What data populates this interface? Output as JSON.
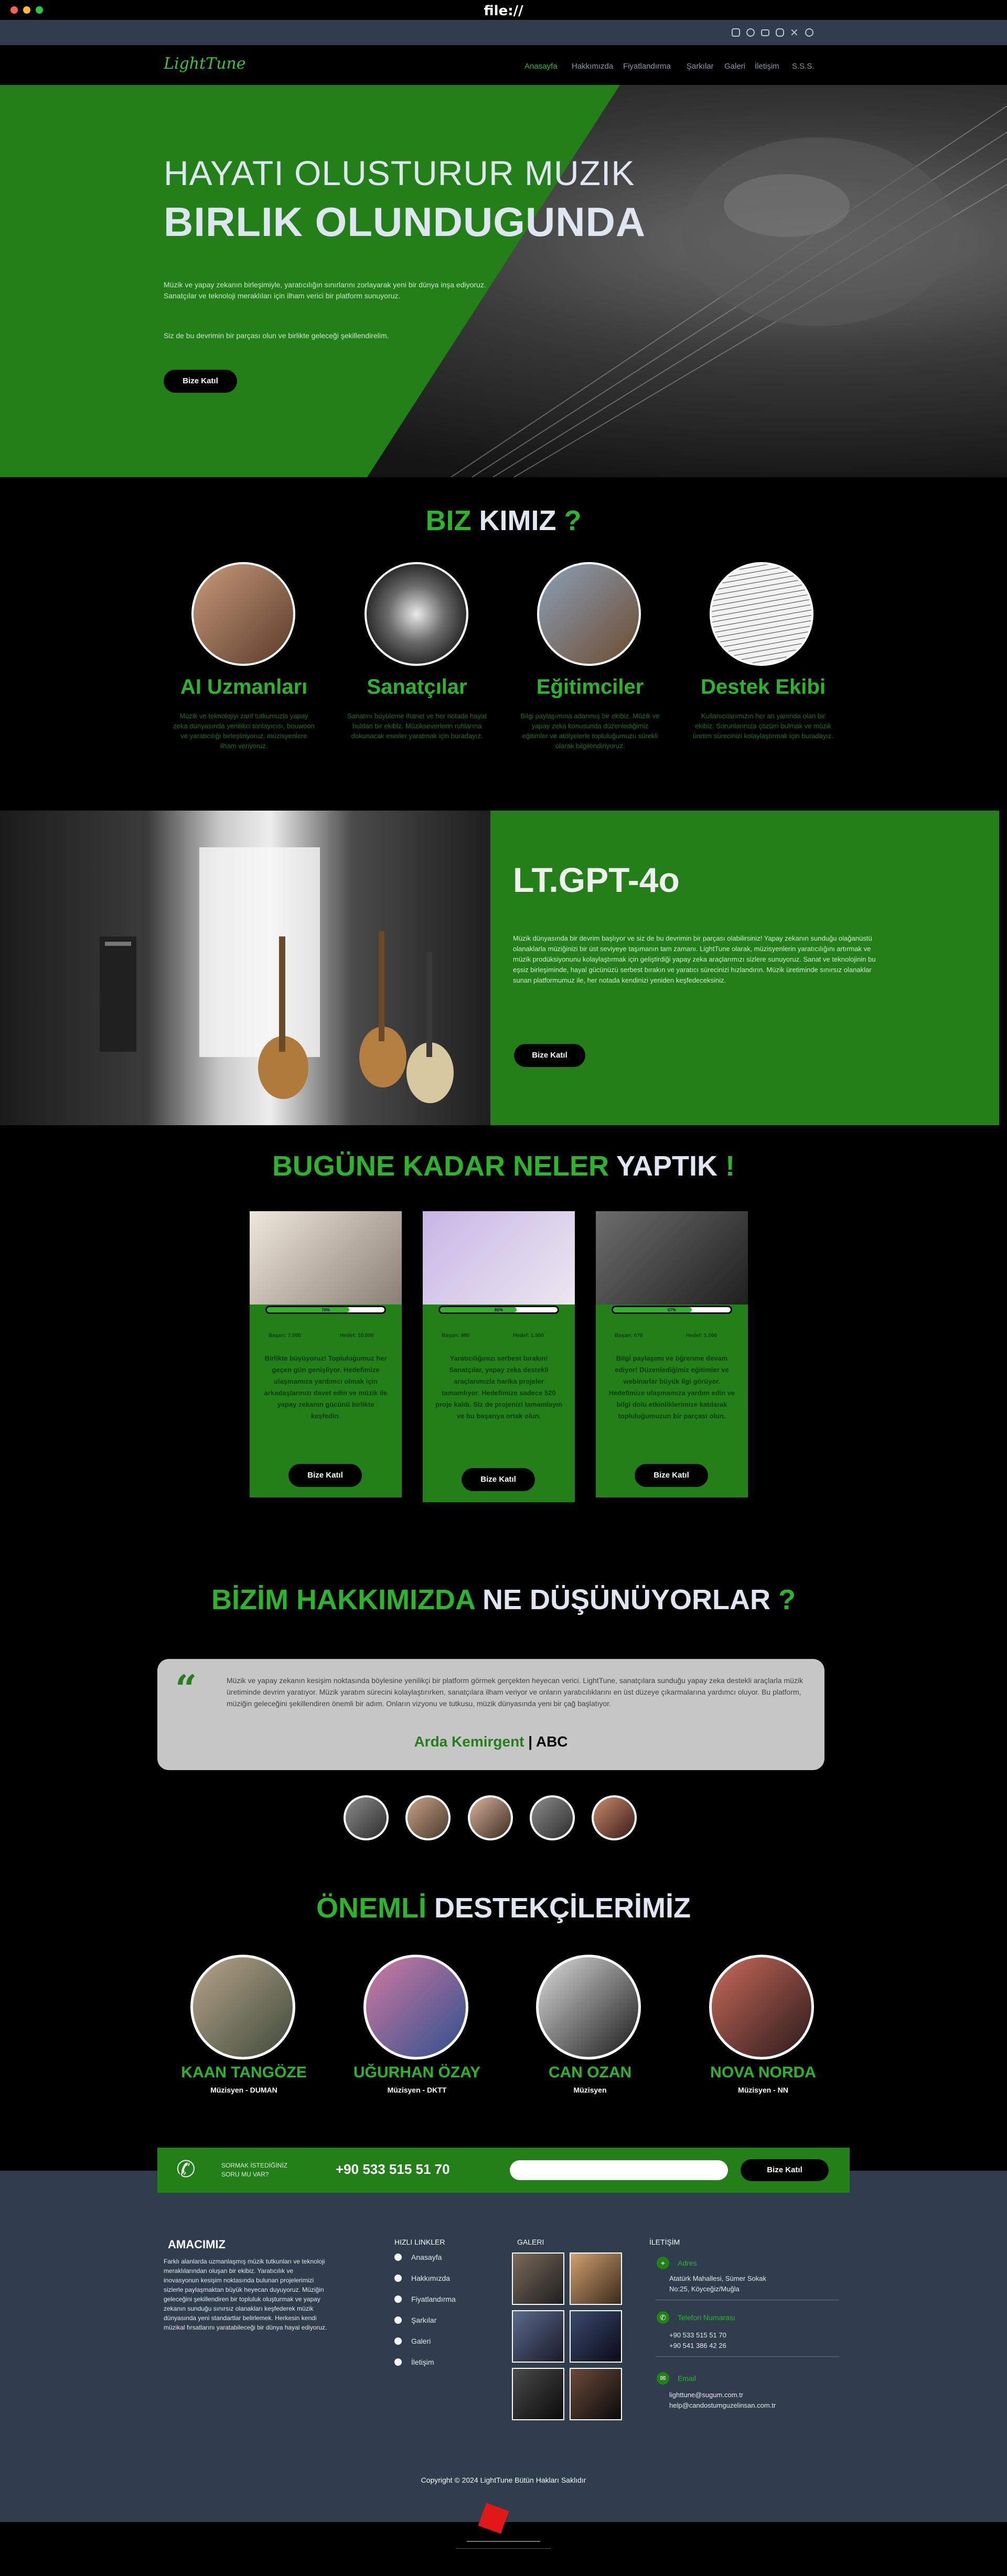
{
  "browser": {
    "url": "file://"
  },
  "nav": {
    "logo": "LightTune",
    "items": [
      "Anasayfa",
      "Hakkımızda",
      "Fiyatlandırma",
      "Şarkılar",
      "Galeri",
      "İletişim",
      "S.S.S."
    ],
    "active": "Anasayfa"
  },
  "hero": {
    "line1": "HAYATI OLUSTURUR MUZIK",
    "line2": "BIRLIK OLUNDUGUNDA",
    "p1": "Müzik ve yapay zekanın birleşimiyle, yaratıcılığın sınırlarını zorlayarak yeni bir dünya inşa ediyoruz. Sanatçılar ve teknoloji meraklıları için ilham verici bir platform sunuyoruz.",
    "p2": "Siz de bu devrimin bir parçası olun ve birlikte geleceği şekillendirelim.",
    "button": "Bize Katıl"
  },
  "about": {
    "title_a": "BIZ",
    "title_b": "KIMIZ",
    "title_c": "?",
    "team": [
      {
        "name": "AI Uzmanları",
        "desc": "Müzik ve teknolojiyi zarif tutkumuzla yapay zeka dünyasında yenilikci tonlayıcısı, bouwoon ve yaratıcılığı birleştiriyoruz, müzisyenlere ilham veriyoruz."
      },
      {
        "name": "Sanatçılar",
        "desc": "Sanatını büyüleme ihanet ve her notada hayat buldan bir ekiblz. Müzikseverlerin ruhlarına dokunacak eserler yaratmak için buradayız."
      },
      {
        "name": "Eğitimciler",
        "desc": "Bilgi paylaşımına adanmış bir ekibiz. Müzik ve yapay zeka konusunda düzenlediğimiz eğitimler ve atölyelerle topluluğumuzu sürekli olarak bilgilendiriyoruz."
      },
      {
        "name": "Destek Ekibi",
        "desc": "Kullanıcılarımızın her an yanında olan bir ekibiz. Sorunlarınıza çözüm bulmak ve müzik üretim sürecinizi kolaylaştırmak için buradayız."
      }
    ]
  },
  "lt": {
    "title": "LT.GPT-4o",
    "body": "Müzik dünyasında bir devrim başlıyor ve siz de bu devrimin bir parçası olabilirsiniz! Yapay zekanın sunduğu olağanüstü olanaklarla müziğinizi bir üst seviyeye taşımanın tam zamanı. LightTune olarak, müzisyenlerin yaratıcılığını artırmak ve müzik prodüksiyonunu kolaylaştırmak için geliştirdiği yapay zeka araçlarımızı sizlere sunuyoruz. Sanat ve teknolojinin bu eşsiz birleşiminde, hayal gücünüzü serbest bırakın ve yaratıcı sürecinizi hızlandırın. Müzik üretiminde sınırsız olanaklar sunan platformumuz ile, her notada kendinizi yeniden keşfedeceksiniz.",
    "button": "Bize Katıl"
  },
  "achievements": {
    "title_a": "BUGÜNE KADAR NELER",
    "title_b": "YAPTIK",
    "title_c": "!",
    "cards": [
      {
        "progress": 0.7,
        "progress_label": "70%",
        "left": "Başarı: 7.000",
        "right": "Hedef: 10.000",
        "text": "Birlikte büyüyoruz! Topluluğumuz her geçen gün genişliyor. Hedefimize ulaşmamıza yardımcı olmak için arkadaşlarınızı davet edin ve müzik ile yapay zekanın gücünü birlikte keşfedin.",
        "button": "Bize Katıl"
      },
      {
        "progress": 0.65,
        "progress_label": "65%",
        "left": "Başarı: 980",
        "right": "Hedef: 1.500",
        "text": "Yaratıcılığınızı serbest bırakın! Sanatçılar, yapay zeka destekli araçlarımızla harika projeler tamamlıyor. Hedefimize sadece 520 proje kaldı. Siz de projenizi tamamlayın ve bu başarıya ortak olun.",
        "button": "Bize Katıl"
      },
      {
        "progress": 0.67,
        "progress_label": "67%",
        "left": "Başarı: 670",
        "right": "Hedef: 1.000",
        "text": "Bilgi paylaşımı ve öğrenme devam ediyor! Düzenlediğimiz eğitimler ve webinarlar büyük ilgi görüyor. Hedefimize ulaşmamıza yardım edin ve bilgi dolu etkinliklerimize katılarak topluluğumuzun bir parçası olun.",
        "button": "Bize Katıl"
      }
    ]
  },
  "testimonials": {
    "title_a": "BİZİM HAKKIMIZDA",
    "title_b": "NE DÜŞÜNÜYORLAR",
    "title_c": "?",
    "quote": "Müzik ve yapay zekanın kesişim noktasında böylesine yenilikçi bir platform görmek gerçekten heyecan verici. LightTune, sanatçılara sunduğu yapay zeka destekli araçlarla müzik üretiminde devrim yaratıyor. Müzik yaratım sürecini kolaylaştırırken, sanatçılara ilham veriyor ve onların yaratıcılıklarını en üst düzeye çıkarmalarına yardımcı oluyor. Bu platform, müziğin geleceğini şekillendiren önemli bir adım. Onların vizyonu ve tutkusu, müzik dünyasında yeni bir çağ başlatıyor.",
    "author": "Arda Kemirgent",
    "company": "ABC"
  },
  "supporters": {
    "title_a": "ÖNEMLİ",
    "title_b": "DESTEKÇİLERİMİZ",
    "people": [
      {
        "name": "KAAN TANGÖZE",
        "role": "Müzisyen - DUMAN"
      },
      {
        "name": "UĞURHAN ÖZAY",
        "role": "Müzisyen - DKTT"
      },
      {
        "name": "CAN OZAN",
        "role": "Müzisyen"
      },
      {
        "name": "NOVA NORDA",
        "role": "Müzisyen - NN"
      }
    ]
  },
  "contact_band": {
    "ask_line1": "SORMAK İSTEDİĞİNİZ",
    "ask_line2": "SORU MU VAR?",
    "phone": "+90 533 515 51 70",
    "input_value": "",
    "button": "Bize Katıl"
  },
  "footer": {
    "about_title": "AMACIMIZ",
    "about_text": "Farklı alanlarda uzmanlaşmış müzik tutkunları ve teknoloji meraklılarından oluşan bir ekibiz. Yaratıcılık ve inovasyonun kesişim noktasında bulunan projelerimizi sizlerle paylaşmaktan büyük heyecan duyuyoruz. Müziğin geleceğini şekillendiren bir topluluk oluşturmak ve yapay zekanın sunduğu sınırsız olanakları keşfederek müzik dünyasında yeni standartlar belirlemek. Herkesin kendi müzikal fırsatlarını yaratabileceği bir dünya hayal ediyoruz.",
    "quick_title": "HIZLI LINKLER",
    "quick_links": [
      "Anasayfa",
      "Hakkımızda",
      "Fiyatlandırma",
      "Şarkılar",
      "Galeri",
      "İletişim"
    ],
    "gallery_title": "GALERI",
    "contact_title": "İLETİŞİM",
    "address_label": "Adres",
    "address_line1": "Atatürk Mahallesi, Sümer Sokak",
    "address_line2": "No:25, Köyceğiz/Muğla",
    "phone_label": "Telefon Numarası",
    "phone1": "+90 533 515 51 70",
    "phone2": "+90 541 386 42 26",
    "email_label": "Email",
    "email1": "lighttune@sugum.com.tr",
    "email2": "help@candostumguzelinsan.com.tr",
    "copyright": "Copyright © 2024 LightTune Bütün Hakları Saklıdır"
  },
  "colors": {
    "accent": "#2cb52c",
    "green_bg": "#238019",
    "footer_bg": "#2f3d4d"
  },
  "icons": [
    "instagram-icon",
    "facebook-icon",
    "youtube-icon",
    "discord-icon",
    "x-icon",
    "github-icon",
    "phone-icon",
    "quote-icon",
    "location-icon",
    "email-icon"
  ]
}
